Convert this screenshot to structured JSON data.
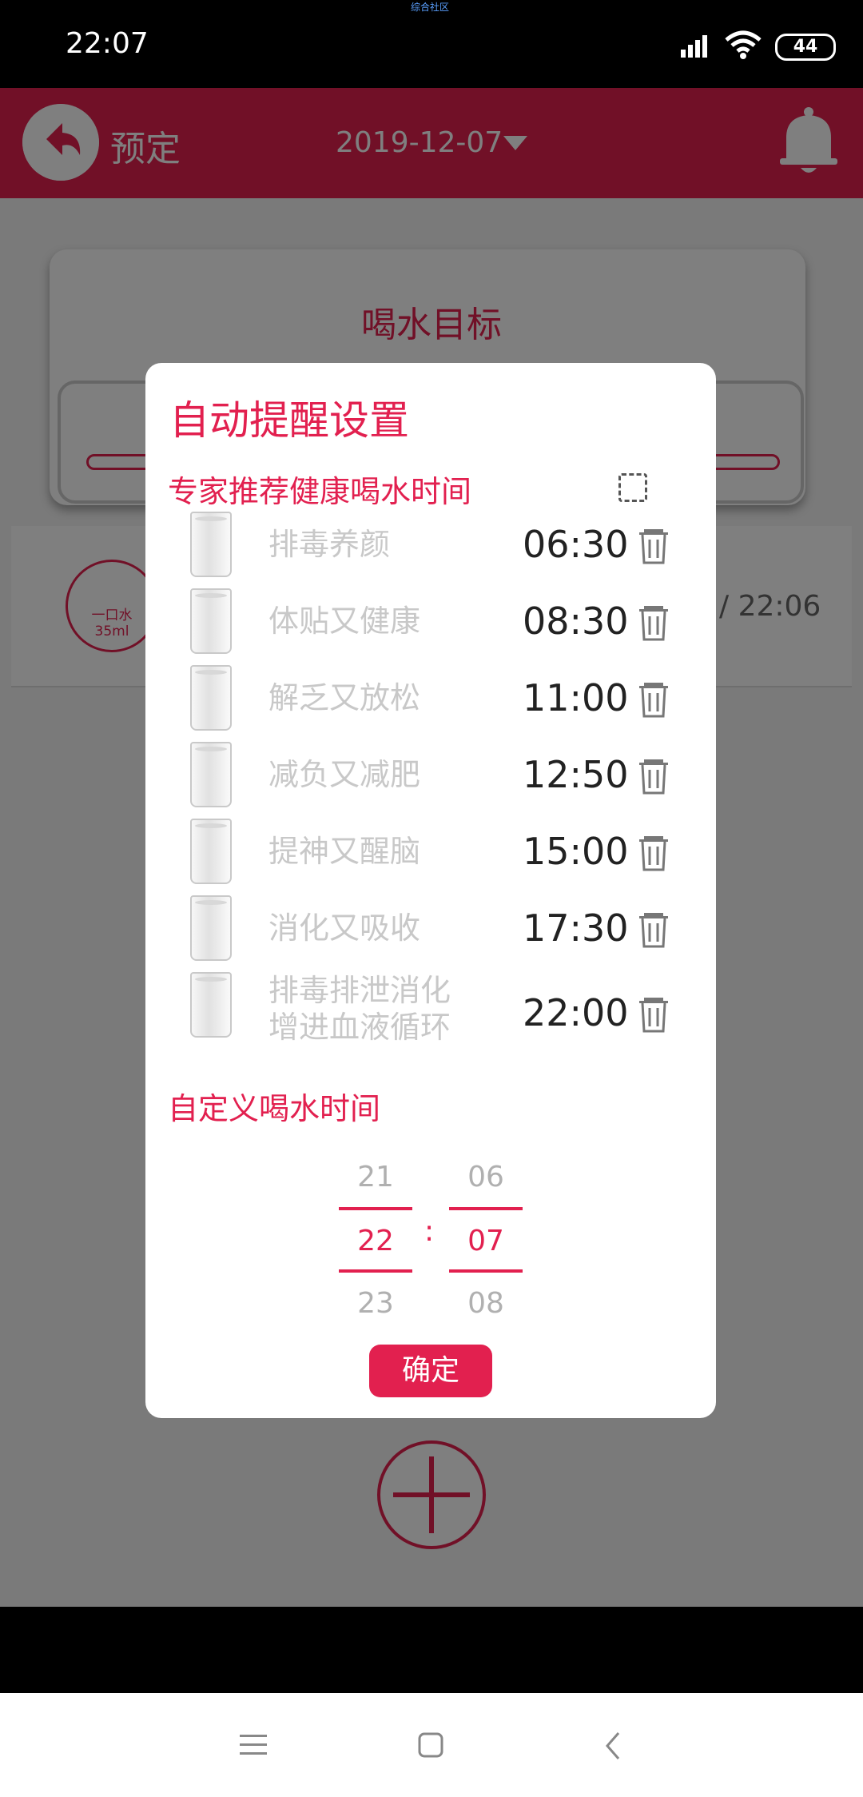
{
  "status_bar": {
    "time": "22:07",
    "watermark": "综合社区",
    "battery": "44"
  },
  "app_bar": {
    "back_label": "预定",
    "date": "2019-12-07"
  },
  "goal_card": {
    "title": "喝水目标"
  },
  "record": {
    "badge_line1": "一口水",
    "badge_line2": "35ml",
    "time": "/ 22:06"
  },
  "dialog": {
    "title": "自动提醒设置",
    "expert_section": "专家推荐健康喝水时间",
    "reminders": [
      {
        "desc": "排毒养颜",
        "time": "06:30"
      },
      {
        "desc": "体贴又健康",
        "time": "08:30"
      },
      {
        "desc": "解乏又放松",
        "time": "11:00"
      },
      {
        "desc": "减负又减肥",
        "time": "12:50"
      },
      {
        "desc": "提神又醒脑",
        "time": "15:00"
      },
      {
        "desc": "消化又吸收",
        "time": "17:30"
      },
      {
        "desc_line1": "排毒排泄消化",
        "desc_line2": "增进血液循环",
        "time": "22:00"
      }
    ],
    "custom_section": "自定义喝水时间",
    "picker": {
      "hour_prev": "21",
      "hour_sel": "22",
      "hour_next": "23",
      "minute_prev": "06",
      "minute_sel": "07",
      "minute_next": "08",
      "separator": ":"
    },
    "confirm_label": "确定"
  },
  "colors": {
    "accent": "#e2204f",
    "scrim": "rgba(0,0,0,0.5)",
    "muted_text": "#c8c8c8"
  },
  "icons": [
    "back-arrow-icon",
    "dropdown-arrow-icon",
    "bell-icon",
    "glass-icon",
    "trash-icon",
    "checkbox-icon",
    "plus-icon",
    "menu-icon",
    "home-square-icon",
    "back-chevron-icon"
  ]
}
